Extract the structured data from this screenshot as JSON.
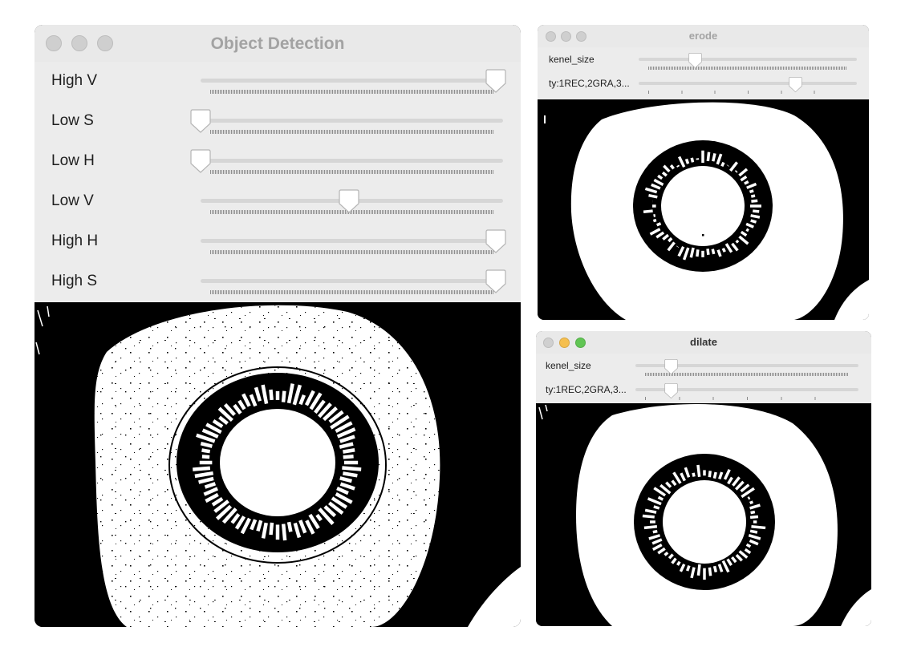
{
  "windows": {
    "object_detection": {
      "title": "Object Detection",
      "traffic_lights": "inactive",
      "sliders": [
        {
          "label": "High V",
          "value": 1.0
        },
        {
          "label": "Low S",
          "value": 0.0
        },
        {
          "label": "Low H",
          "value": 0.0
        },
        {
          "label": "Low V",
          "value": 0.49
        },
        {
          "label": "High H",
          "value": 1.0
        },
        {
          "label": "High S",
          "value": 1.0
        }
      ]
    },
    "erode": {
      "title": "erode",
      "traffic_lights": "inactive",
      "sliders": [
        {
          "label": "kenel_size",
          "value": 0.26
        },
        {
          "label": "ty:1REC,2GRA,3...",
          "value": 0.72
        }
      ]
    },
    "dilate": {
      "title": "dilate",
      "traffic_lights": "active",
      "sliders": [
        {
          "label": "kenel_size",
          "value": 0.16
        },
        {
          "label": "ty:1REC,2GRA,3...",
          "value": 0.16
        }
      ]
    }
  },
  "colors": {
    "titlebar": "#e9e9e9",
    "panel": "#ececec",
    "close_red": "#ed6a5e",
    "minimize_yellow": "#f5bf4f",
    "zoom_green": "#61c554",
    "inactive_light": "#cfcfcf"
  }
}
